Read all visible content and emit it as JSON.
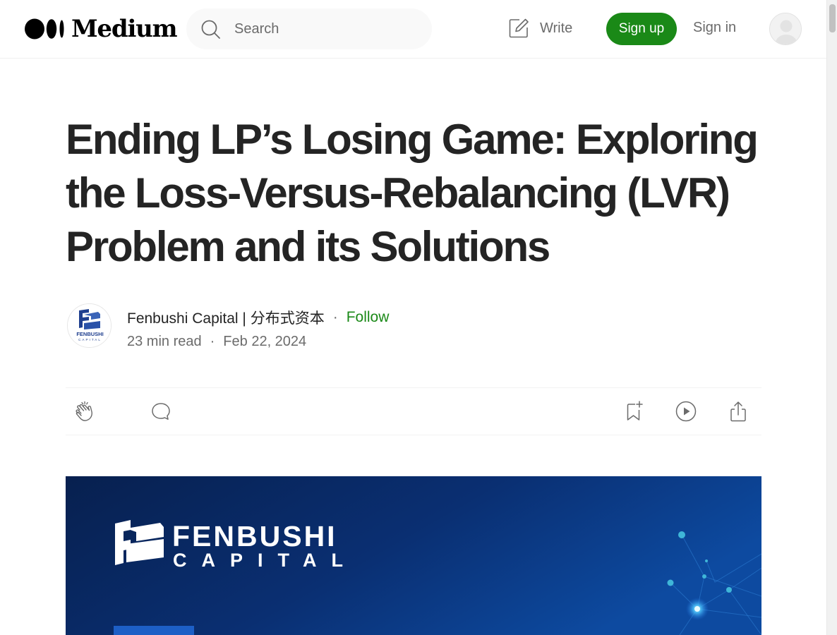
{
  "header": {
    "logo_text": "Medium",
    "search_placeholder": "Search",
    "write_label": "Write",
    "signup_label": "Sign up",
    "signin_label": "Sign in",
    "brand_color": "#1a8917"
  },
  "article": {
    "title": "Ending LP’s Losing Game: Exploring the Loss-Versus-Rebalancing (LVR) Problem and its Solutions",
    "author": "Fenbushi Capital | 分布式资本",
    "separator": "·",
    "follow_label": "Follow",
    "read_time": "23 min read",
    "date": "Feb 22, 2024",
    "author_logo_text": "FENBUSHI",
    "author_logo_subtext": "CAPITAL"
  },
  "actions": {
    "icons": [
      "clap-icon",
      "comment-icon",
      "bookmark-add-icon",
      "listen-icon",
      "share-icon"
    ]
  },
  "hero": {
    "brand_line1": "FENBUSHI",
    "brand_line2": "CAPITAL",
    "background_color": "#0b2a6b"
  }
}
